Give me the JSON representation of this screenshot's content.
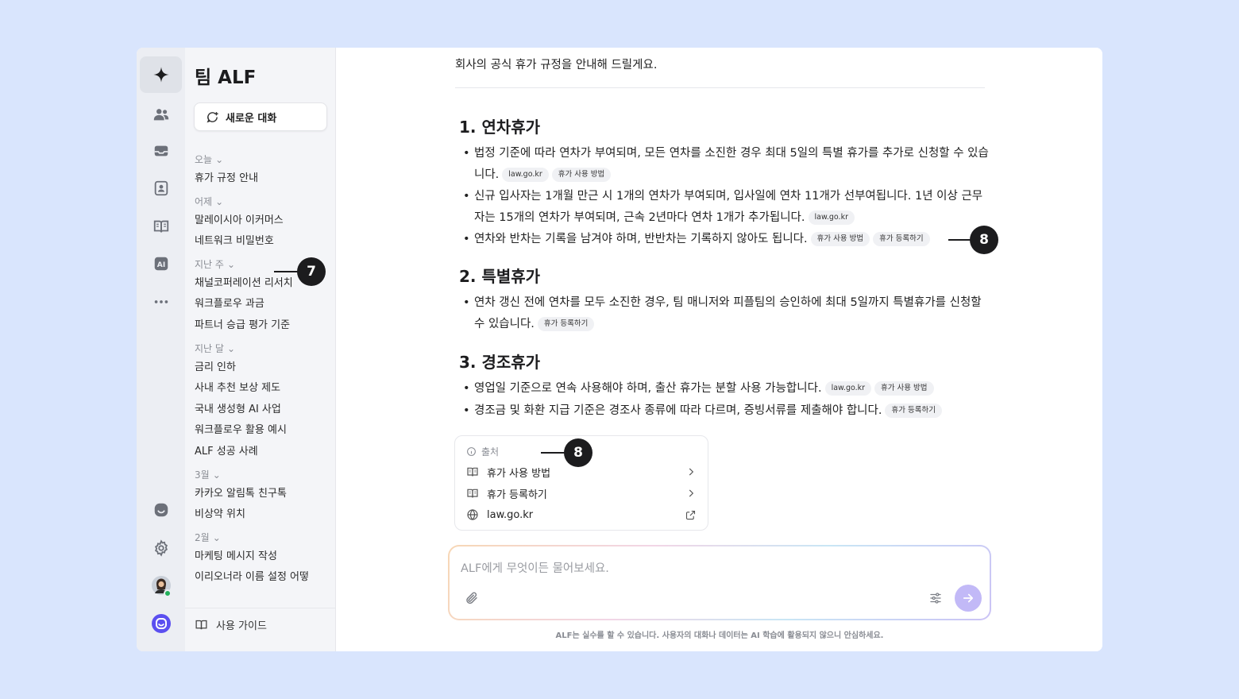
{
  "sidebar": {
    "title": "팀 ALF",
    "new_chat": "새로운 대화",
    "groups": [
      {
        "label": "오늘",
        "items": [
          "휴가 규정 안내"
        ]
      },
      {
        "label": "어제",
        "items": [
          "말레이시아 이커머스",
          "네트워크 비밀번호"
        ]
      },
      {
        "label": "지난 주",
        "items": [
          "채널코퍼레이션 리서치",
          "워크플로우 과금",
          "파트너 승급 평가 기준"
        ]
      },
      {
        "label": "지난 달",
        "items": [
          "금리 인하",
          "사내 추천 보상 제도",
          "국내 생성형 AI 사업",
          "워크플로우 활용 예시",
          "ALF 성공 사례"
        ]
      },
      {
        "label": "3월",
        "items": [
          "카카오 알림톡 친구톡",
          "비상약 위치"
        ]
      },
      {
        "label": "2월",
        "items": [
          "마케팅 메시지 작성",
          "이리오너라 이름 설정 어떻"
        ]
      }
    ],
    "guide": "사용 가이드"
  },
  "rail": {
    "icons": [
      "sparkle-icon",
      "team-icon",
      "inbox-icon",
      "contacts-icon",
      "book-icon",
      "ai-icon",
      "more-icon",
      "chat-icon",
      "settings-icon",
      "avatar",
      "channel-logo"
    ],
    "status_color": "#22b05a"
  },
  "main": {
    "intro": "회사의 공식 휴가 규정을 안내해 드릴게요.",
    "sections": [
      {
        "title": "1. 연차휴가",
        "bullets": [
          {
            "text": "법정 기준에 따라 연차가 부여되며, 모든 연차를 소진한 경우 최대 5일의 특별 휴가를 추가로 신청할 수 있습니다.",
            "chips": [
              "law.go.kr",
              "휴가 사용 방법"
            ]
          },
          {
            "text": "신규 입사자는 1개월 만근 시 1개의 연차가 부여되며, 입사일에 연차 11개가 선부여됩니다. 1년 이상 근무자는 15개의 연차가 부여되며, 근속 2년마다 연차 1개가 추가됩니다.",
            "chips": [
              "law.go.kr"
            ]
          },
          {
            "text": "연차와 반차는 기록을 남겨야 하며, 반반차는 기록하지 않아도 됩니다.",
            "chips": [
              "휴가 사용 방법",
              "휴가 등록하기"
            ]
          }
        ]
      },
      {
        "title": "2. 특별휴가",
        "bullets": [
          {
            "text": "연차 갱신 전에 연차를 모두 소진한 경우, 팀 매니저와 피플팀의 승인하에 최대 5일까지 특별휴가를 신청할 수 있습니다.",
            "chips": [
              "휴가 등록하기"
            ]
          }
        ]
      },
      {
        "title": "3. 경조휴가",
        "bullets": [
          {
            "text": "영업일 기준으로 연속 사용해야 하며, 출산 휴가는 분할 사용 가능합니다.",
            "chips": [
              "law.go.kr",
              "휴가 사용 방법"
            ]
          },
          {
            "text": "경조금 및 화환 지급 기준은 경조사 종류에 따라 다르며, 증빙서류를 제출해야 합니다.",
            "chips": [
              "휴가 등록하기"
            ]
          }
        ]
      }
    ],
    "sources": {
      "title": "출처",
      "items": [
        {
          "label": "휴가 사용 방법",
          "icon": "book-icon",
          "end": "chevron-right-icon"
        },
        {
          "label": "휴가 등록하기",
          "icon": "book-icon",
          "end": "chevron-right-icon"
        },
        {
          "label": "law.go.kr",
          "icon": "globe-icon",
          "end": "external-link-icon"
        }
      ]
    },
    "composer": {
      "placeholder": "ALF에게 무엇이든 물어보세요."
    },
    "disclaimer": "ALF는 실수를 할 수 있습니다. 사용자의 대화나 데이터는 AI 학습에 활용되지 않으니 안심하세요."
  },
  "callouts": {
    "sidebar": "7",
    "citation": "8",
    "sources": "8"
  },
  "colors": {
    "background": "#d9e5fd",
    "accent": "#c2b9f7",
    "brand": "#5b4ff0",
    "callout": "#1c1c1e"
  }
}
